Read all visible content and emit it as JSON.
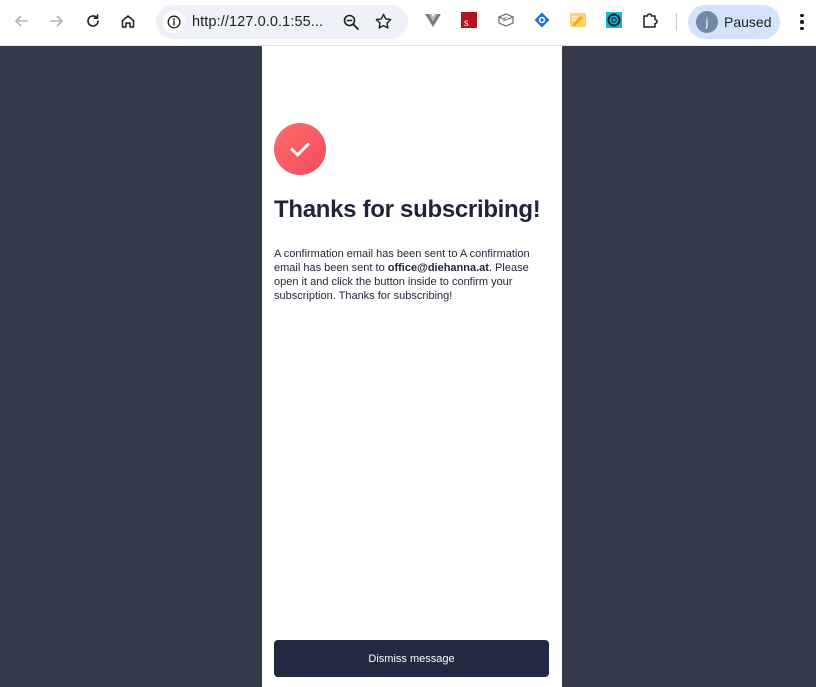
{
  "browser": {
    "url": "http://127.0.0.1:55...",
    "profile": {
      "initial": "j",
      "status": "Paused"
    },
    "extensions": [
      {
        "icon": "vue-devtools-icon"
      },
      {
        "icon": "s-extension-icon",
        "label": "S"
      },
      {
        "icon": "reader-extension-icon"
      },
      {
        "icon": "blue-diamond-extension-icon"
      },
      {
        "icon": "notes-extension-icon"
      },
      {
        "icon": "lifebuoy-extension-icon"
      },
      {
        "icon": "puzzle-extensions-icon"
      }
    ],
    "colors": {
      "toolbar": "#ffffff",
      "omnibox": "#eef1f7",
      "profile_chip": "#d3e3fd"
    }
  },
  "page": {
    "heading": "Thanks for subscribing!",
    "message_before": "A confirmation email has been sent to A confirmation email has been sent to ",
    "email": "office@diehanna.at",
    "message_after": ". Please open it and click the button inside to confirm your subscription. Thanks for subscribing!",
    "dismiss_label": "Dismiss message",
    "colors": {
      "background": "#363a4d",
      "panel": "#ffffff",
      "accent_from": "#ff6b6b",
      "accent_to": "#f24b61",
      "button": "#222a40",
      "text": "#1e2538"
    }
  }
}
